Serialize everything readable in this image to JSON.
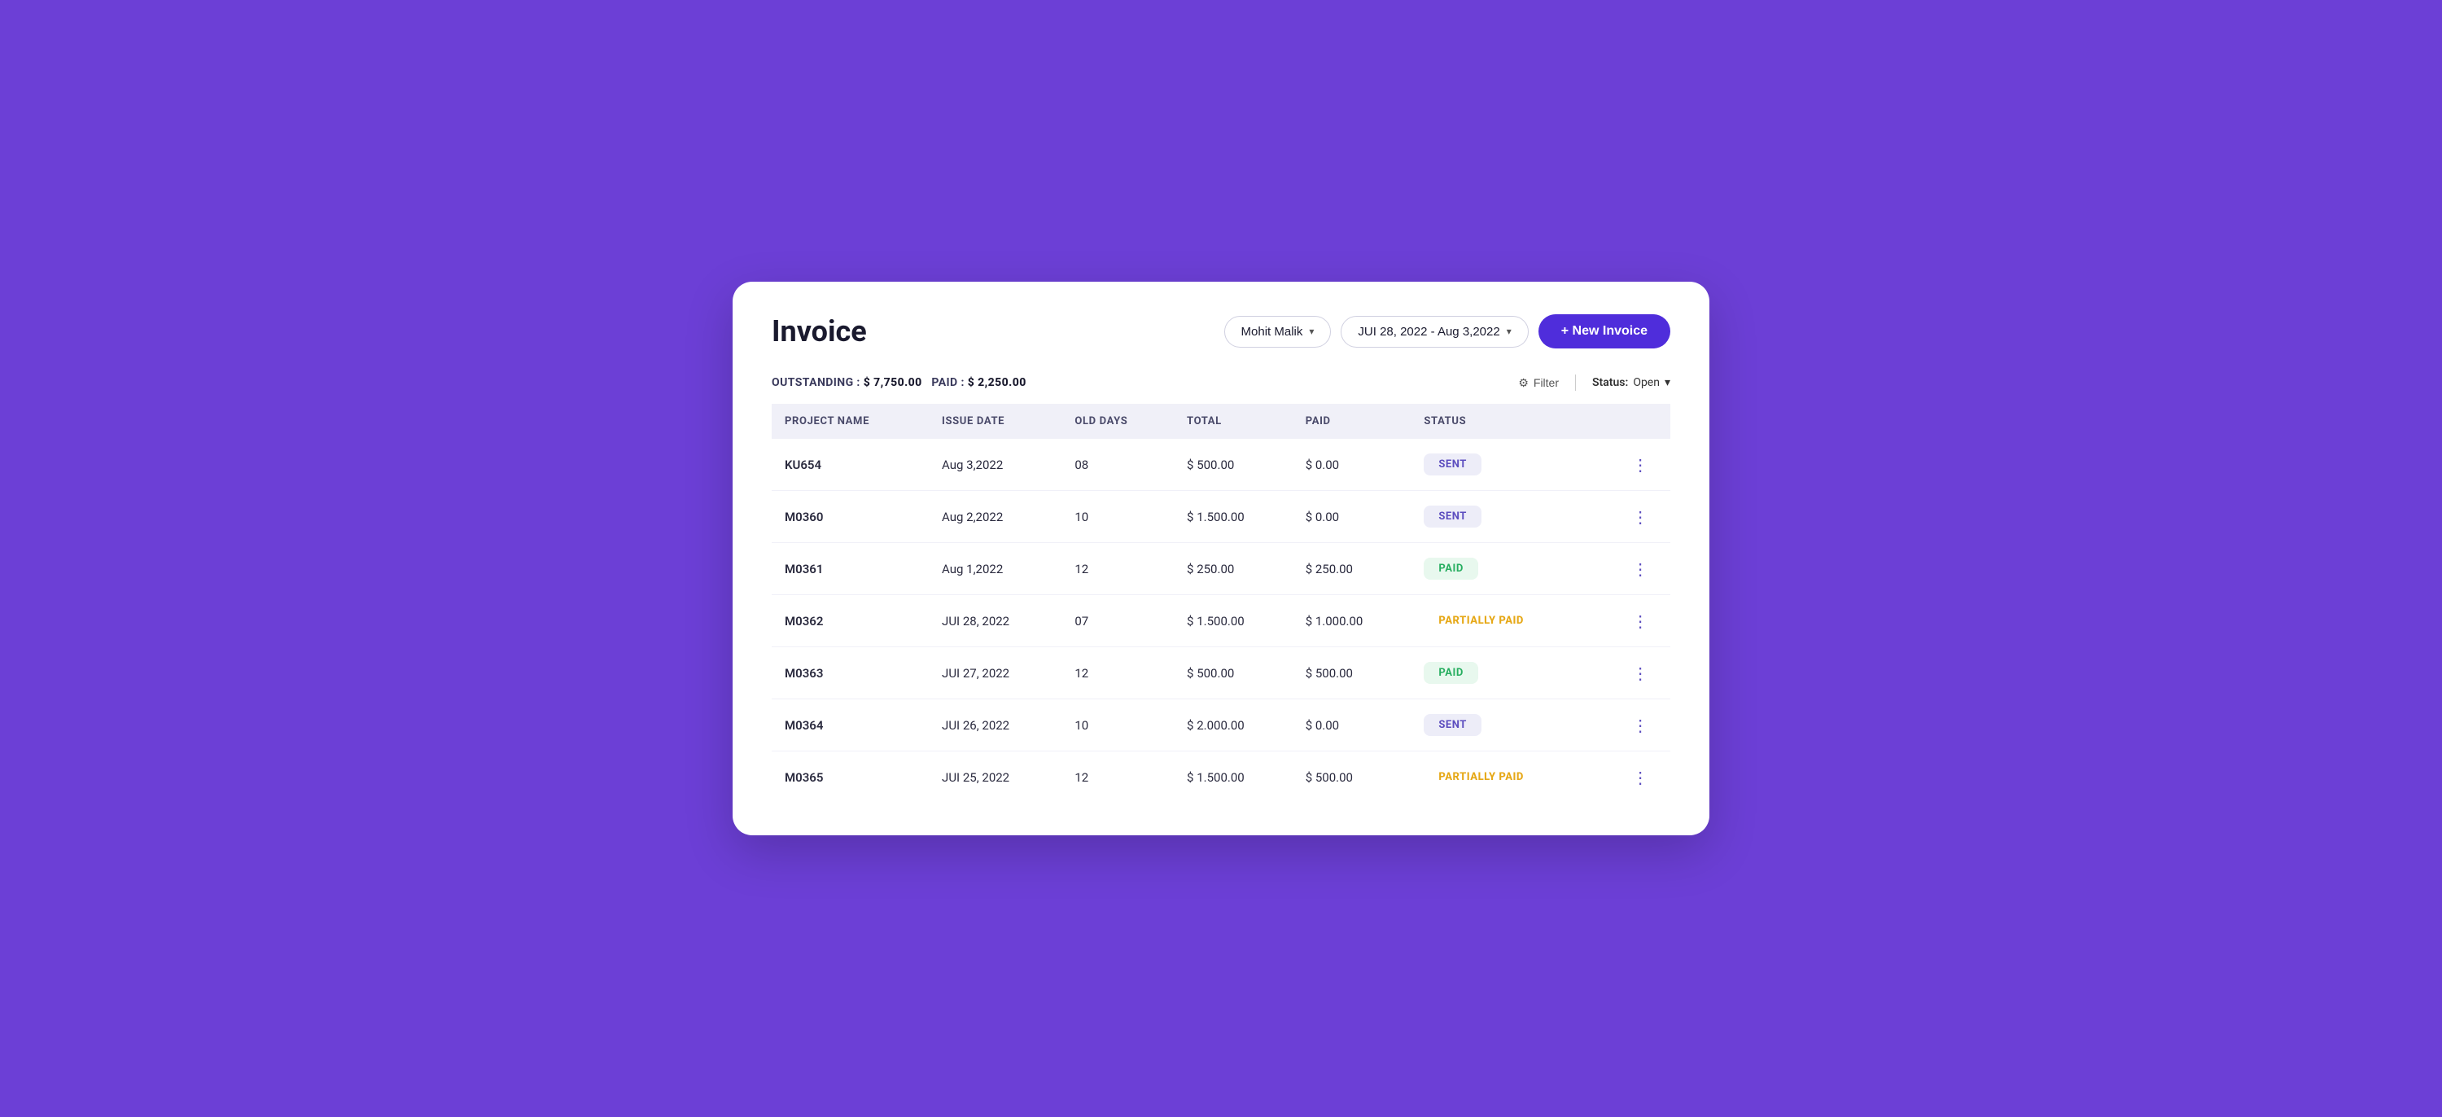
{
  "header": {
    "title": "Invoice",
    "user_dropdown": "Mohit Malik",
    "date_range": "JUI 28, 2022 - Aug 3,2022",
    "new_invoice_label": "+ New Invoice",
    "filter_label": "Filter",
    "status_label": "Status:",
    "status_value": "Open"
  },
  "summary": {
    "outstanding_label": "OUTSTANDING :",
    "outstanding_amount": "$ 7,750.00",
    "paid_label": "PAID :",
    "paid_amount": "$ 2,250.00"
  },
  "table": {
    "columns": [
      "PROJECT NAME",
      "ISSUE DATE",
      "OLD DAYS",
      "TOTAL",
      "PAID",
      "STATUS",
      ""
    ],
    "rows": [
      {
        "project": "KU654",
        "issue_date": "Aug 3,2022",
        "old_days": "08",
        "total": "$ 500.00",
        "paid": "$ 0.00",
        "status": "SENT",
        "status_type": "sent"
      },
      {
        "project": "M0360",
        "issue_date": "Aug 2,2022",
        "old_days": "10",
        "total": "$ 1.500.00",
        "paid": "$ 0.00",
        "status": "SENT",
        "status_type": "sent"
      },
      {
        "project": "M0361",
        "issue_date": "Aug 1,2022",
        "old_days": "12",
        "total": "$ 250.00",
        "paid": "$ 250.00",
        "status": "PAID",
        "status_type": "paid"
      },
      {
        "project": "M0362",
        "issue_date": "JUI 28, 2022",
        "old_days": "07",
        "total": "$ 1.500.00",
        "paid": "$ 1.000.00",
        "status": "PARTIALLY PAID",
        "status_type": "partial"
      },
      {
        "project": "M0363",
        "issue_date": "JUI 27, 2022",
        "old_days": "12",
        "total": "$ 500.00",
        "paid": "$ 500.00",
        "status": "PAID",
        "status_type": "paid"
      },
      {
        "project": "M0364",
        "issue_date": "JUI 26, 2022",
        "old_days": "10",
        "total": "$ 2.000.00",
        "paid": "$ 0.00",
        "status": "SENT",
        "status_type": "sent"
      },
      {
        "project": "M0365",
        "issue_date": "JUI 25, 2022",
        "old_days": "12",
        "total": "$ 1.500.00",
        "paid": "$ 500.00",
        "status": "PARTIALLY PAID",
        "status_type": "partial"
      }
    ]
  }
}
